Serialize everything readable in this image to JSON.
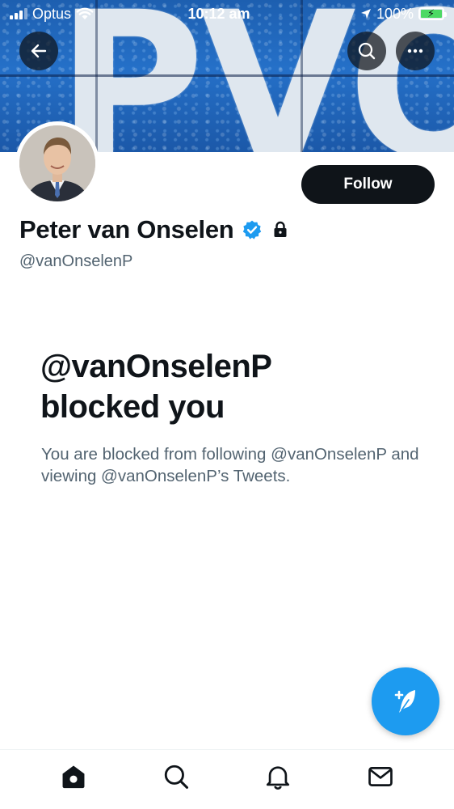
{
  "status_bar": {
    "carrier": "Optus",
    "time": "10:12 am",
    "battery": "100%"
  },
  "banner": {
    "text": "PVO"
  },
  "profile": {
    "display_name": "Peter van Onselen",
    "handle": "@vanOnselenP",
    "verified": true,
    "protected": true,
    "follow_label": "Follow"
  },
  "blocked": {
    "title_line1": "@vanOnselenP",
    "title_line2": "blocked you",
    "description": "You are blocked from following @vanOnselenP and viewing @vanOnselenP’s Tweets."
  },
  "fab": {
    "icon": "compose-tweet-icon"
  },
  "tab_bar": {
    "tabs": [
      {
        "name": "home",
        "icon": "home-icon"
      },
      {
        "name": "search",
        "icon": "search-icon"
      },
      {
        "name": "notifications",
        "icon": "bell-icon"
      },
      {
        "name": "messages",
        "icon": "mail-icon"
      }
    ]
  },
  "colors": {
    "accent": "#1d9bf0",
    "text_primary": "#0f1419",
    "text_secondary": "#536471",
    "battery_green": "#4cd964"
  }
}
